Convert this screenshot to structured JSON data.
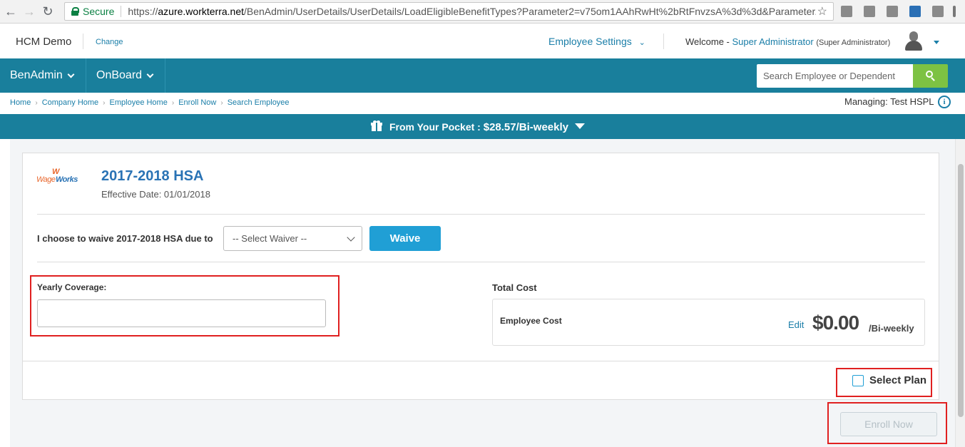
{
  "browser": {
    "secure_label": "Secure",
    "url_scheme": "https://",
    "url_host": "azure.workterra.net",
    "url_path": "/BenAdmin/UserDetails/UserDetails/LoadEligibleBenefitTypes?Parameter2=v75om1AAhRwHt%2bRtFnvzsA%3d%3d&Parameter...",
    "icons": [
      "back-icon",
      "forward-icon",
      "reload-icon",
      "star-icon"
    ]
  },
  "header": {
    "company": "HCM Demo",
    "change_link": "Change",
    "employee_settings": "Employee Settings",
    "welcome_prefix": "Welcome -",
    "user_name": "Super Administrator",
    "user_role": "(Super Administrator)"
  },
  "navbar": {
    "items": [
      {
        "label": "BenAdmin"
      },
      {
        "label": "OnBoard"
      }
    ],
    "search_placeholder": "Search Employee or Dependent",
    "colors": {
      "bar": "#197f9c",
      "search_button": "#7dc243"
    }
  },
  "breadcrumb": [
    "Home",
    "Company Home",
    "Employee Home",
    "Enroll Now",
    "Search Employee"
  ],
  "managing": {
    "label": "Managing:",
    "value": "Test HSPL"
  },
  "pocket": {
    "label": "From Your Pocket :",
    "amount": "$28.57/Bi-weekly"
  },
  "plan": {
    "logo_text_wage": "Wage",
    "logo_text_works": "Works",
    "logo_mark": "W",
    "title": "2017-2018 HSA",
    "effective_date": "Effective Date: 01/01/2018",
    "waive_text": "I choose to waive 2017-2018 HSA due to",
    "waiver_select_value": "-- Select Waiver --",
    "waive_button": "Waive",
    "yearly_coverage_label": "Yearly Coverage:",
    "yearly_coverage_value": "",
    "total_cost_label": "Total Cost",
    "employee_cost_label": "Employee Cost",
    "edit_link": "Edit",
    "employee_cost_amount": "$0.00",
    "employee_cost_period": "/Bi-weekly",
    "select_plan_label": "Select Plan",
    "select_plan_checked": false
  },
  "enroll_button": "Enroll Now",
  "colors": {
    "accent": "#209fd5",
    "link": "#1a7ea8",
    "highlight": "#e02020"
  }
}
